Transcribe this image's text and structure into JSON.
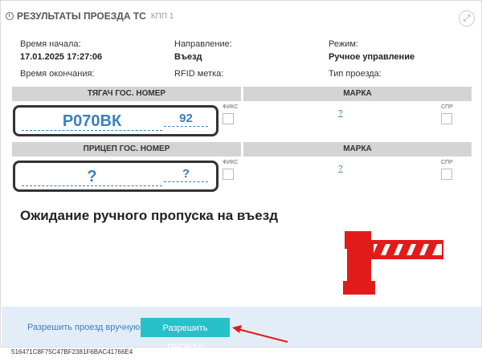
{
  "panel": {
    "title": "РЕЗУЛЬТАТЫ ПРОЕЗДА ТС",
    "subtitle": "КПП 1"
  },
  "info": {
    "start_label": "Время начала:",
    "start_value": "17.01.2025 17:27:06",
    "direction_label": "Направление:",
    "direction_value": "Въезд",
    "mode_label": "Режим:",
    "mode_value": "Ручное управление",
    "end_label": "Время окончания:",
    "rfid_label": "RFID метка:",
    "pass_type_label": "Тип проезда:"
  },
  "tractor": {
    "header": "ТЯГАЧ ГОС. НОМЕР",
    "plate_main": "Р070ВК",
    "plate_region": "92",
    "fix_label": "ФИКС",
    "brand_header": "МАРКА",
    "brand_value": "?",
    "spr_label": "СПР"
  },
  "trailer": {
    "header": "ПРИЦЕП ГОС. НОМЕР",
    "plate_main": "?",
    "plate_region": "?",
    "fix_label": "ФИКС",
    "brand_header": "МАРКА",
    "brand_value": "?",
    "spr_label": "СПР"
  },
  "status": {
    "waiting_text": "Ожидание ручного пропуска на въезд"
  },
  "actions": {
    "manual_link": "Разрешить проезд вручную",
    "allow_button": "Разрешить ПРОЕЗД"
  },
  "hash": "516471C8F75C47BF2381F6BAC41766E4",
  "colors": {
    "accent": "#27c1c9",
    "link": "#3a7fc0",
    "barrier": "#e31a1a",
    "arrow": "#e31a1a",
    "footer_bg": "#e3edf8"
  }
}
